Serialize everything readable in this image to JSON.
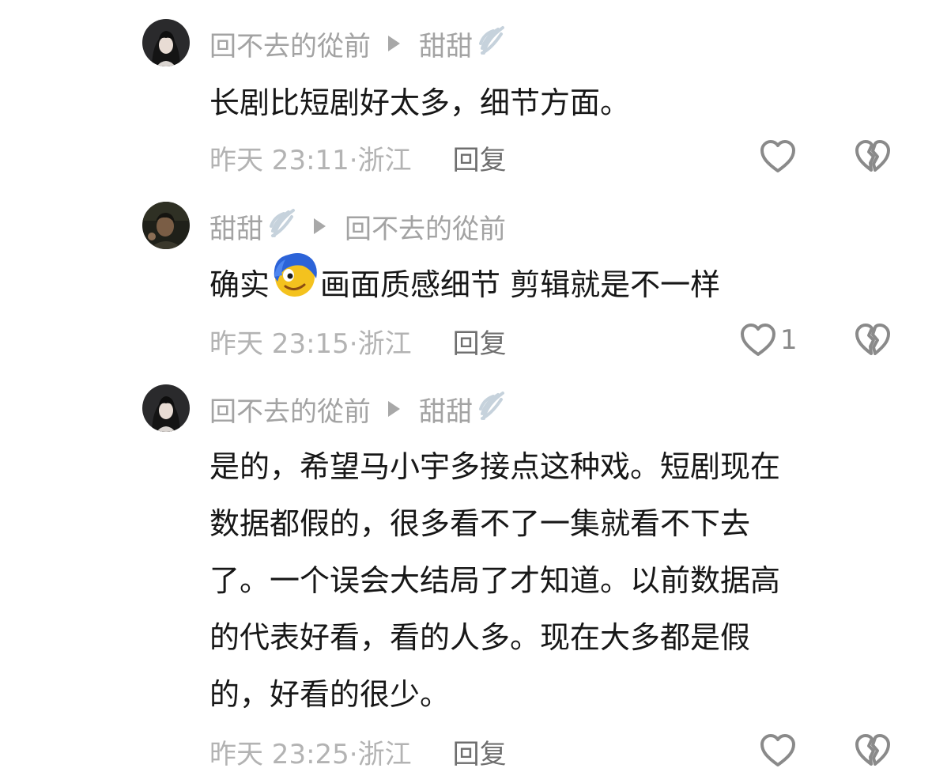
{
  "comments": [
    {
      "author": "回不去的從前",
      "reply_to": "甜甜",
      "reply_to_badge": "wing-icon",
      "text_lines": [
        "长剧比短剧好太多，细节方面。"
      ],
      "time": "昨天 23:11·",
      "location": " 浙江",
      "reply_label": "回复",
      "like_count": ""
    },
    {
      "author": "甜甜",
      "author_badge": "wing-icon",
      "reply_to": "回不去的從前",
      "text_before_emoji": "确实",
      "emoji": "silly-face-emoji",
      "text_after_emoji": "画面质感细节  剪辑就是不一样",
      "time": "昨天 23:15·",
      "location": " 浙江",
      "reply_label": "回复",
      "like_count": "1"
    },
    {
      "author": "回不去的從前",
      "reply_to": "甜甜",
      "reply_to_badge": "wing-icon",
      "text_lines": [
        "是的，希望马小宇多接点这种戏。短剧现在",
        "数据都假的，很多看不了一集就看不下去",
        "了。一个误会大结局了才知道。以前数据高",
        "的代表好看，看的人多。现在大多都是假",
        "的，好看的很少。"
      ],
      "time": "昨天 23:25·",
      "location": " 浙江",
      "reply_label": "回复",
      "like_count": ""
    }
  ],
  "colors": {
    "name_gray": "#a3a3a3",
    "body_text": "#171717",
    "meta_gray": "#b3b3b3",
    "reply_gray": "#6e6e6e",
    "icon_gray": "#8a8a8a"
  }
}
